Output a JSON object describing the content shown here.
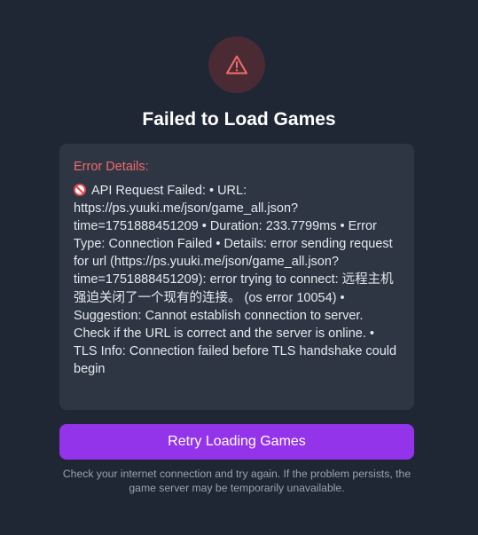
{
  "header": {
    "icon": "warning-triangle-icon",
    "title": "Failed to Load Games"
  },
  "error": {
    "heading": "Error Details:",
    "icon": "no-entry-icon",
    "message": "API Request Failed: • URL: https://ps.yuuki.me/json/game_all.json?time=1751888451209 • Duration: 233.7799ms • Error Type: Connection Failed • Details: error sending request for url (https://ps.yuuki.me/json/game_all.json?time=1751888451209): error trying to connect: 远程主机强迫关闭了一个现有的连接。 (os error 10054) • Suggestion: Cannot establish connection to server. Check if the URL is correct and the server is online. • TLS Info: Connection failed before TLS handshake could begin"
  },
  "actions": {
    "retry_label": "Retry Loading Games"
  },
  "footer": {
    "help_text": "Check your internet connection and try again. If the problem persists, the game server may be temporarily unavailable."
  },
  "colors": {
    "background": "#1f2634",
    "panel": "#2e3644",
    "error_red": "#f26a6a",
    "accent_purple": "#9333ea",
    "icon_circle": "#4a2b34"
  }
}
